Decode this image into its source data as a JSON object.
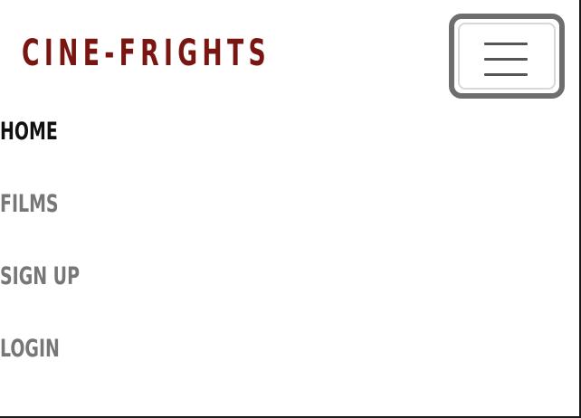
{
  "navbar": {
    "brand": "CINE-FRIGHTS",
    "toggler_icon": "hamburger-menu-icon",
    "items": [
      {
        "label": "HOME",
        "active": true
      },
      {
        "label": "FILMS",
        "active": false
      },
      {
        "label": "SIGN UP",
        "active": false
      },
      {
        "label": "LOGIN",
        "active": false
      }
    ]
  },
  "colors": {
    "brand": "#7a1612",
    "nav_active": "#111111",
    "nav_inactive": "#777777",
    "toggler_border": "#6e6e6e",
    "background": "#ffffff"
  }
}
